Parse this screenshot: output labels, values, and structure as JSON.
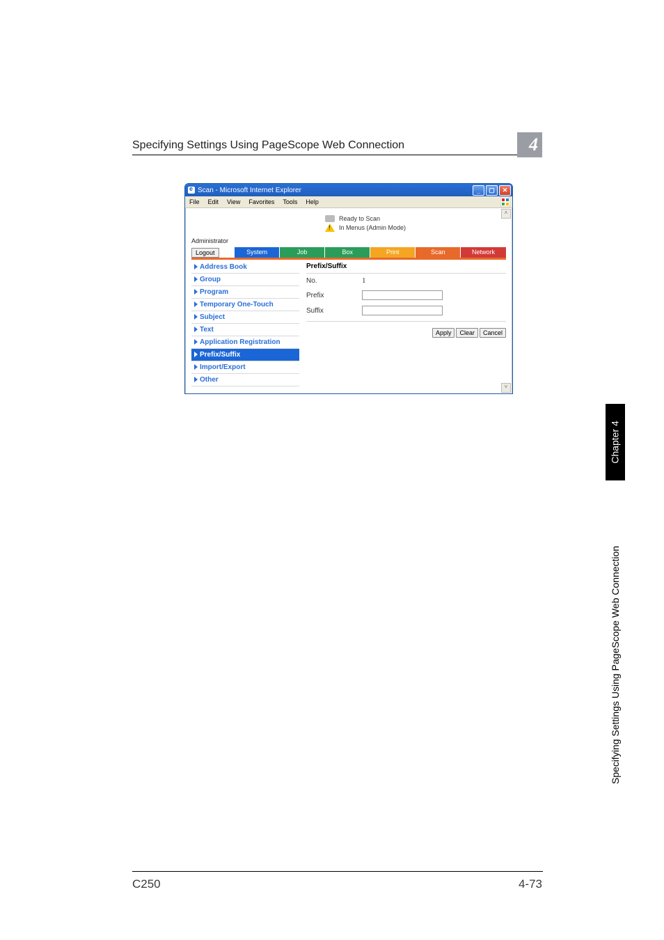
{
  "section_header": "Specifying Settings Using PageScope Web Connection",
  "chapter_number": "4",
  "right_tab_black": "Chapter 4",
  "right_tab_text": "Specifying Settings Using PageScope Web Connection",
  "footer_left": "C250",
  "footer_right": "4-73",
  "browser": {
    "title": "Scan - Microsoft Internet Explorer",
    "menubar": [
      "File",
      "Edit",
      "View",
      "Favorites",
      "Tools",
      "Help"
    ],
    "status_line1": "Ready to Scan",
    "status_line2": "In Menus (Admin Mode)",
    "admin_label": "Administrator",
    "logout": "Logout",
    "tabs": {
      "system": "System",
      "job": "Job",
      "box": "Box",
      "print": "Print",
      "scan": "Scan",
      "network": "Network"
    },
    "sidebar": [
      "Address Book",
      "Group",
      "Program",
      "Temporary One-Touch",
      "Subject",
      "Text",
      "Application Registration",
      "Prefix/Suffix",
      "Import/Export",
      "Other"
    ],
    "main": {
      "heading": "Prefix/Suffix",
      "no_label": "No.",
      "no_value": "1",
      "prefix_label": "Prefix",
      "prefix_value": "",
      "suffix_label": "Suffix",
      "suffix_value": "",
      "buttons": {
        "apply": "Apply",
        "clear": "Clear",
        "cancel": "Cancel"
      }
    }
  }
}
